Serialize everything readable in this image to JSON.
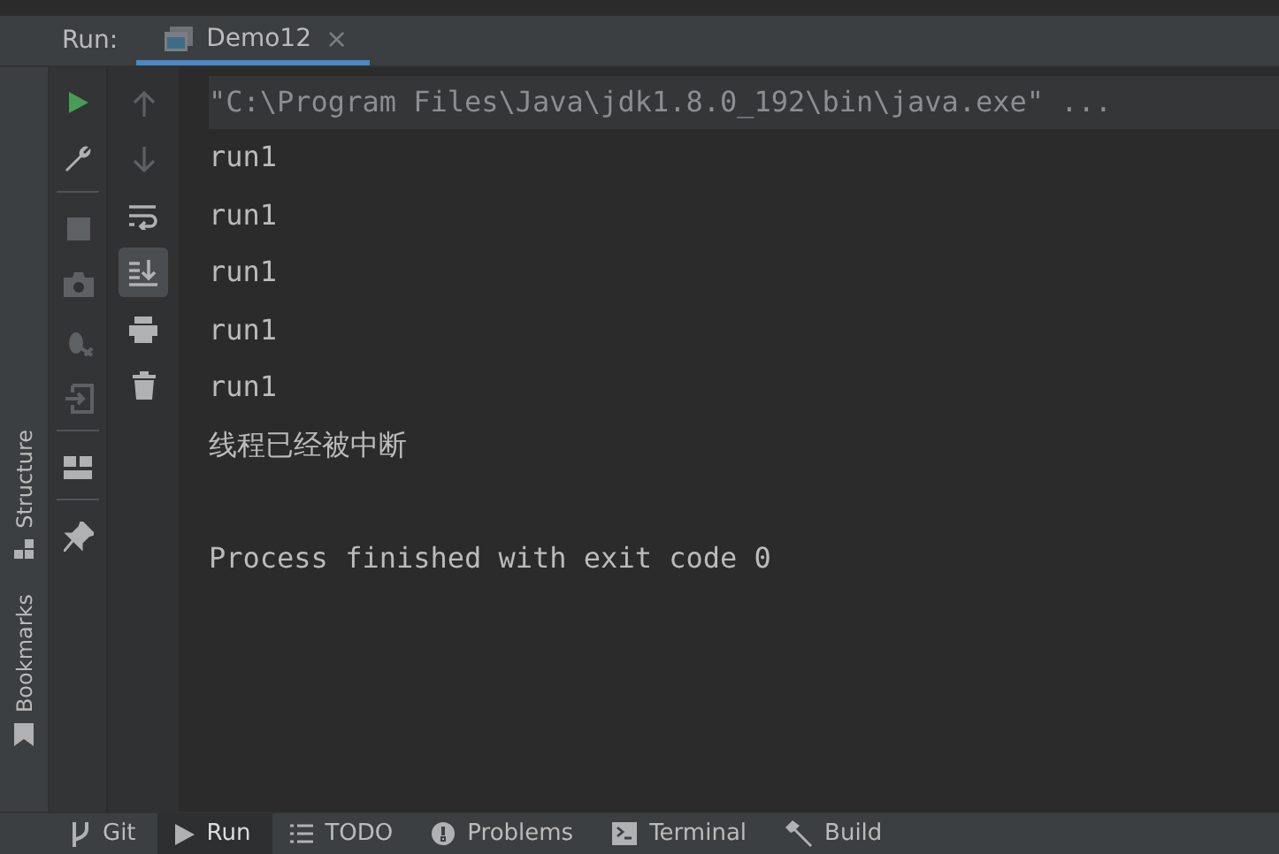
{
  "run_panel": {
    "label": "Run:",
    "tabs": [
      {
        "label": "Demo12",
        "selected": true,
        "close": "×"
      }
    ]
  },
  "side_stripe": [
    {
      "label": "Structure",
      "kind": "structure"
    },
    {
      "label": "Bookmarks",
      "kind": "bookmark"
    }
  ],
  "toolbar_1": [
    {
      "kind": "run",
      "disabled": false
    },
    {
      "kind": "wrench",
      "disabled": false
    },
    {
      "kind": "stop",
      "disabled": true
    },
    {
      "kind": "camera",
      "disabled": true
    },
    {
      "kind": "debug",
      "disabled": true
    },
    {
      "kind": "exit",
      "disabled": true
    },
    {
      "kind": "layout",
      "disabled": false
    },
    {
      "kind": "pin",
      "disabled": false
    }
  ],
  "toolbar_2": [
    {
      "kind": "up",
      "disabled": true,
      "selected": false
    },
    {
      "kind": "down",
      "disabled": true,
      "selected": false
    },
    {
      "kind": "wrap",
      "disabled": false,
      "selected": false
    },
    {
      "kind": "scroll",
      "disabled": false,
      "selected": true
    },
    {
      "kind": "print",
      "disabled": false,
      "selected": false
    },
    {
      "kind": "trash",
      "disabled": false,
      "selected": false
    }
  ],
  "console": [
    {
      "kind": "command",
      "text": "\"C:\\Program Files\\Java\\jdk1.8.0_192\\bin\\java.exe\" ..."
    },
    {
      "kind": "out",
      "text": "run1"
    },
    {
      "kind": "out",
      "text": "run1"
    },
    {
      "kind": "out",
      "text": "run1"
    },
    {
      "kind": "out",
      "text": "run1"
    },
    {
      "kind": "out",
      "text": "run1"
    },
    {
      "kind": "out",
      "text": "线程已经被中断"
    },
    {
      "kind": "exit",
      "text": "Process finished with exit code 0"
    }
  ],
  "bottom_tabs": [
    {
      "label": "Git",
      "kind": "git",
      "selected": false
    },
    {
      "label": "Run",
      "kind": "run",
      "selected": true
    },
    {
      "label": "TODO",
      "kind": "todo",
      "selected": false
    },
    {
      "label": "Problems",
      "kind": "problems",
      "selected": false
    },
    {
      "label": "Terminal",
      "kind": "terminal",
      "selected": false
    },
    {
      "label": "Build",
      "kind": "build",
      "selected": false
    }
  ]
}
